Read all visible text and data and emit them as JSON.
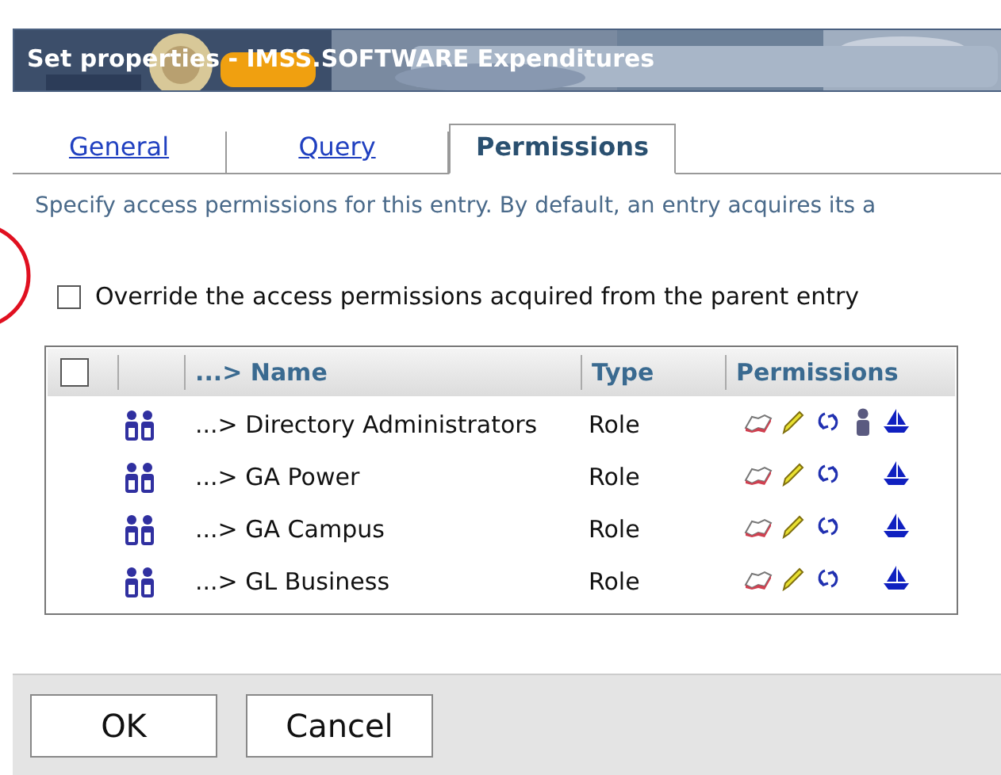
{
  "window": {
    "title": "Set properties - IMSS.SOFTWARE Expenditures"
  },
  "tabs": [
    {
      "label": "General",
      "selected": false
    },
    {
      "label": "Query",
      "selected": false
    },
    {
      "label": "Permissions",
      "selected": true
    }
  ],
  "description": "Specify access permissions for this entry. By default, an entry acquires its a",
  "override": {
    "label": "Override the access permissions acquired from the parent entry",
    "checked": false
  },
  "table": {
    "select_all_checked": false,
    "columns": [
      "...> Name",
      "Type",
      "Permissions"
    ],
    "rows": [
      {
        "name": "...> Directory Administrators",
        "type": "Role",
        "can_administer": true
      },
      {
        "name": "...> GA Power",
        "type": "Role",
        "can_administer": false
      },
      {
        "name": "...> GA Campus",
        "type": "Role",
        "can_administer": false
      },
      {
        "name": "...> GL Business",
        "type": "Role",
        "can_administer": false
      }
    ]
  },
  "buttons": [
    "OK",
    "Cancel"
  ]
}
